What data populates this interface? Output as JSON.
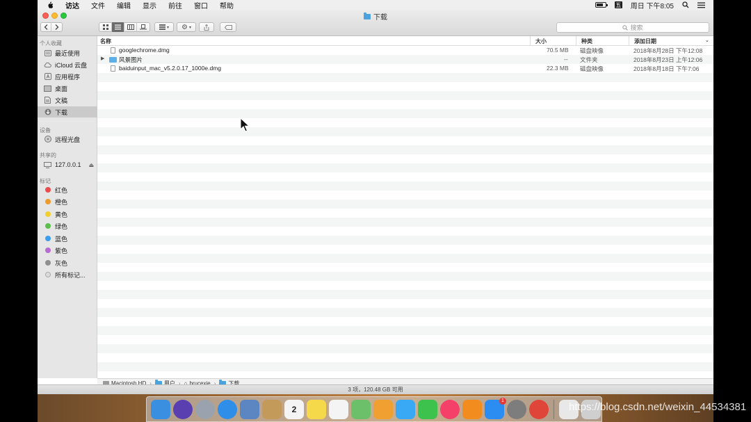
{
  "menubar": {
    "items": [
      "访达",
      "文件",
      "编辑",
      "显示",
      "前往",
      "窗口",
      "帮助"
    ],
    "clock": "周日 下午8:05",
    "ime": "五",
    "battery_level": 0.8
  },
  "window": {
    "title": "下载",
    "search_placeholder": "搜索",
    "action_icon": "gear-icon",
    "share_icon": "share-icon",
    "tag_icon": "tag-icon"
  },
  "sidebar": {
    "favorites_header": "个人收藏",
    "favorites": [
      {
        "label": "最近使用",
        "icon": "clock-icon"
      },
      {
        "label": "iCloud 云盘",
        "icon": "cloud-icon"
      },
      {
        "label": "应用程序",
        "icon": "apps-icon"
      },
      {
        "label": "桌面",
        "icon": "desktop-icon"
      },
      {
        "label": "文稿",
        "icon": "document-icon"
      },
      {
        "label": "下载",
        "icon": "download-icon"
      }
    ],
    "devices_header": "设备",
    "devices": [
      {
        "label": "远程光盘",
        "icon": "disc-icon"
      }
    ],
    "shared_header": "共享的",
    "shared": [
      {
        "label": "127.0.0.1",
        "icon": "monitor-icon"
      }
    ],
    "tags_header": "标记",
    "tags": [
      {
        "label": "红色",
        "color": "#ec4b4b"
      },
      {
        "label": "橙色",
        "color": "#f09a2b"
      },
      {
        "label": "黄色",
        "color": "#f1cf2e"
      },
      {
        "label": "绿色",
        "color": "#5ac04a"
      },
      {
        "label": "蓝色",
        "color": "#3a9df0"
      },
      {
        "label": "紫色",
        "color": "#b66ad2"
      },
      {
        "label": "灰色",
        "color": "#8f8f8f"
      },
      {
        "label": "所有标记...",
        "color": "#dcdcdc"
      }
    ]
  },
  "columns": {
    "name": "名称",
    "size": "大小",
    "kind": "种类",
    "date": "添加日期"
  },
  "files": [
    {
      "name": "googlechrome.dmg",
      "size": "70.5 MB",
      "kind": "磁盘映像",
      "date": "2018年8月28日 下午12:08",
      "type": "file"
    },
    {
      "name": "风景图片",
      "size": "--",
      "kind": "文件夹",
      "date": "2018年8月23日 上午12:06",
      "type": "folder"
    },
    {
      "name": "baiduinput_mac_v5.2.0.17_1000e.dmg",
      "size": "22.3 MB",
      "kind": "磁盘映像",
      "date": "2018年8月18日 下午7:06",
      "type": "file"
    }
  ],
  "pathbar": [
    "Macintosh HD",
    "用户",
    "brucexie",
    "下载"
  ],
  "status": "3 项，120.48 GB 可用",
  "dock": [
    {
      "name": "finder-icon",
      "color": "#3b8fe0"
    },
    {
      "name": "siri-icon",
      "color": "#5a3fb0"
    },
    {
      "name": "launchpad-icon",
      "color": "#9aa3ad"
    },
    {
      "name": "safari-icon",
      "color": "#2f8ee8"
    },
    {
      "name": "mail-photo-icon",
      "color": "#5b86c2"
    },
    {
      "name": "contacts-icon",
      "color": "#c49a5a"
    },
    {
      "name": "calendar-icon",
      "color": "#f4f4f4",
      "text": "2"
    },
    {
      "name": "notes-icon",
      "color": "#f6d94a"
    },
    {
      "name": "reminders-icon",
      "color": "#f4f4f4"
    },
    {
      "name": "maps-icon",
      "color": "#6cc06a"
    },
    {
      "name": "photos-icon",
      "color": "#f0a030"
    },
    {
      "name": "messages-icon",
      "color": "#39a9f5"
    },
    {
      "name": "facetime-icon",
      "color": "#3cc24d"
    },
    {
      "name": "music-icon",
      "color": "#f5406a"
    },
    {
      "name": "books-icon",
      "color": "#f28c1f"
    },
    {
      "name": "app-store-icon",
      "color": "#2b8cf2",
      "badge": "1"
    },
    {
      "name": "system-preferences-icon",
      "color": "#7d7d7d"
    },
    {
      "name": "chrome-icon",
      "color": "#e0453a"
    },
    {
      "name": "downloads-stack-icon",
      "color": "#e8e8e8"
    },
    {
      "name": "trash-icon",
      "color": "#cfcfcf"
    }
  ],
  "watermark": "https://blog.csdn.net/weixin_44534381"
}
